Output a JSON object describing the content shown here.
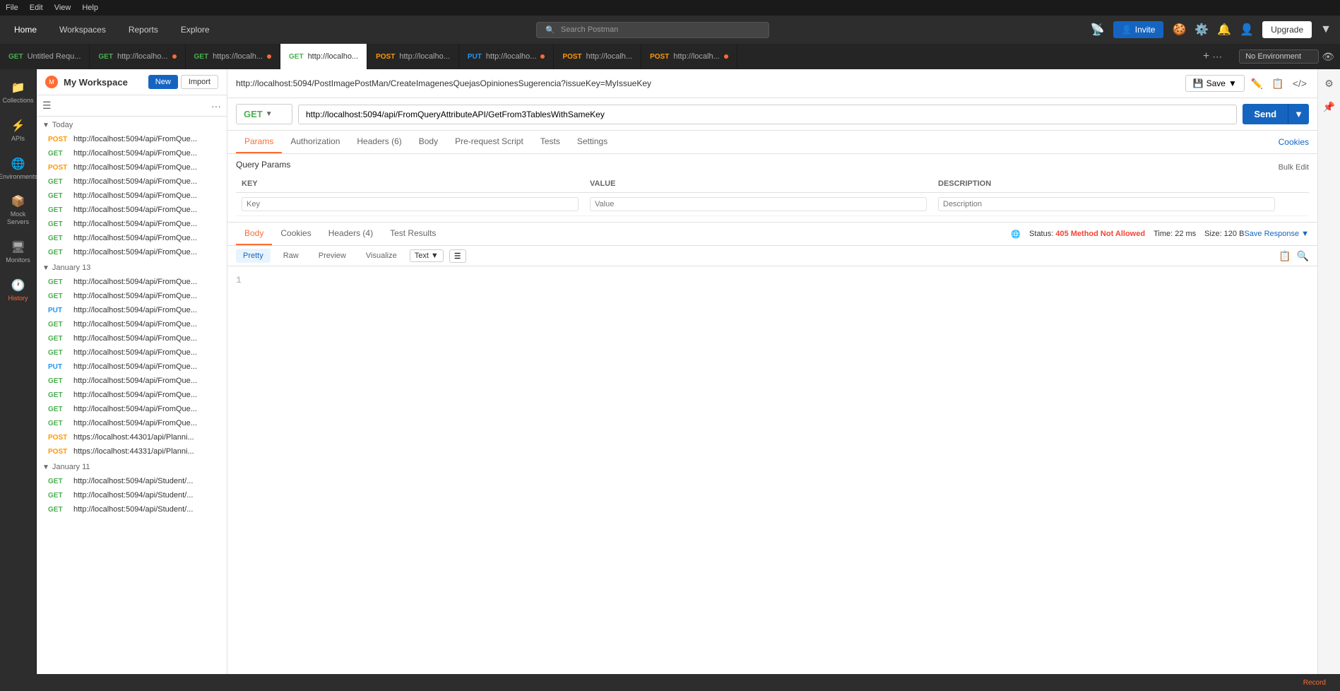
{
  "fileMenu": {
    "items": [
      "File",
      "Edit",
      "View",
      "Help"
    ]
  },
  "topNav": {
    "home": "Home",
    "workspaces": "Workspaces",
    "reports": "Reports",
    "explore": "Explore",
    "search_placeholder": "Search Postman",
    "invite_label": "Invite",
    "upgrade_label": "Upgrade"
  },
  "tabs": [
    {
      "method": "GET",
      "url": "Untitled Requ...",
      "active": false,
      "dot": false
    },
    {
      "method": "GET",
      "url": "http://localho...",
      "active": false,
      "dot": true
    },
    {
      "method": "GET",
      "url": "https://localh...",
      "active": false,
      "dot": true
    },
    {
      "method": "GET",
      "url": "http://localho...",
      "active": true,
      "dot": false
    },
    {
      "method": "POST",
      "url": "http://localho...",
      "active": false,
      "dot": false
    },
    {
      "method": "PUT",
      "url": "http://localho...",
      "active": false,
      "dot": true
    },
    {
      "method": "POST",
      "url": "http://localh...",
      "active": false,
      "dot": false
    },
    {
      "method": "POST",
      "url": "http://localh...",
      "active": false,
      "dot": true
    }
  ],
  "workspace": {
    "name": "My Workspace"
  },
  "sidebar": {
    "icons": [
      {
        "id": "collections",
        "label": "Collections",
        "icon": "📁",
        "active": false
      },
      {
        "id": "apis",
        "label": "APIs",
        "icon": "⚡",
        "active": false
      },
      {
        "id": "environments",
        "label": "Environments",
        "icon": "🌐",
        "active": false
      },
      {
        "id": "mock-servers",
        "label": "Mock Servers",
        "icon": "📦",
        "active": false
      },
      {
        "id": "monitors",
        "label": "Monitors",
        "icon": "🖥",
        "active": false
      },
      {
        "id": "history",
        "label": "History",
        "icon": "🕐",
        "active": true
      }
    ]
  },
  "history": {
    "sections": [
      {
        "title": "Today",
        "expanded": true,
        "items": [
          {
            "method": "POST",
            "url": "http://localhost:5094/api/FromQue..."
          },
          {
            "method": "GET",
            "url": "http://localhost:5094/api/FromQue..."
          },
          {
            "method": "POST",
            "url": "http://localhost:5094/api/FromQue..."
          },
          {
            "method": "GET",
            "url": "http://localhost:5094/api/FromQue..."
          },
          {
            "method": "GET",
            "url": "http://localhost:5094/api/FromQue..."
          },
          {
            "method": "GET",
            "url": "http://localhost:5094/api/FromQue..."
          },
          {
            "method": "GET",
            "url": "http://localhost:5094/api/FromQue..."
          },
          {
            "method": "GET",
            "url": "http://localhost:5094/api/FromQue..."
          },
          {
            "method": "GET",
            "url": "http://localhost:5094/api/FromQue..."
          }
        ]
      },
      {
        "title": "January 13",
        "expanded": true,
        "items": [
          {
            "method": "GET",
            "url": "http://localhost:5094/api/FromQue..."
          },
          {
            "method": "GET",
            "url": "http://localhost:5094/api/FromQue..."
          },
          {
            "method": "PUT",
            "url": "http://localhost:5094/api/FromQue..."
          },
          {
            "method": "GET",
            "url": "http://localhost:5094/api/FromQue..."
          },
          {
            "method": "GET",
            "url": "http://localhost:5094/api/FromQue..."
          },
          {
            "method": "GET",
            "url": "http://localhost:5094/api/FromQue..."
          },
          {
            "method": "PUT",
            "url": "http://localhost:5094/api/FromQue..."
          },
          {
            "method": "GET",
            "url": "http://localhost:5094/api/FromQue..."
          },
          {
            "method": "GET",
            "url": "http://localhost:5094/api/FromQue..."
          },
          {
            "method": "GET",
            "url": "http://localhost:5094/api/FromQue..."
          },
          {
            "method": "GET",
            "url": "http://localhost:5094/api/FromQue..."
          },
          {
            "method": "POST",
            "url": "https://localhost:44301/api/Planni..."
          },
          {
            "method": "POST",
            "url": "https://localhost:44331/api/Planni..."
          }
        ]
      },
      {
        "title": "January 11",
        "expanded": true,
        "items": [
          {
            "method": "GET",
            "url": "http://localhost:5094/api/Student/..."
          },
          {
            "method": "GET",
            "url": "http://localhost:5094/api/Student/..."
          },
          {
            "method": "GET",
            "url": "http://localhost:5094/api/Student/..."
          }
        ]
      }
    ]
  },
  "request": {
    "breadcrumb_url": "http://localhost:5094/PostImagePostMan/CreateImagenesQuejasOpinionesSugerencia?issueKey=MyIssueKey",
    "method": "GET",
    "url": "http://localhost:5094/api/FromQueryAttributeAPI/GetFrom3TablesWithSameKey",
    "tabs": [
      "Params",
      "Authorization",
      "Headers (6)",
      "Body",
      "Pre-request Script",
      "Tests",
      "Settings"
    ],
    "active_tab": "Params",
    "cookies_label": "Cookies",
    "query_params_title": "Query Params",
    "params_columns": [
      "KEY",
      "VALUE",
      "DESCRIPTION"
    ],
    "bulk_edit": "Bulk Edit"
  },
  "response": {
    "tabs": [
      "Body",
      "Cookies",
      "Headers (4)",
      "Test Results"
    ],
    "active_tab": "Body",
    "status": "405 Method Not Allowed",
    "time": "22 ms",
    "size": "120 B",
    "save_response": "Save Response",
    "format_tabs": [
      "Pretty",
      "Raw",
      "Preview",
      "Visualize"
    ],
    "active_format": "Pretty",
    "text_label": "Text",
    "line_1": "1"
  },
  "statusBar": {
    "record": "Record"
  },
  "noEnvironment": "No Environment"
}
